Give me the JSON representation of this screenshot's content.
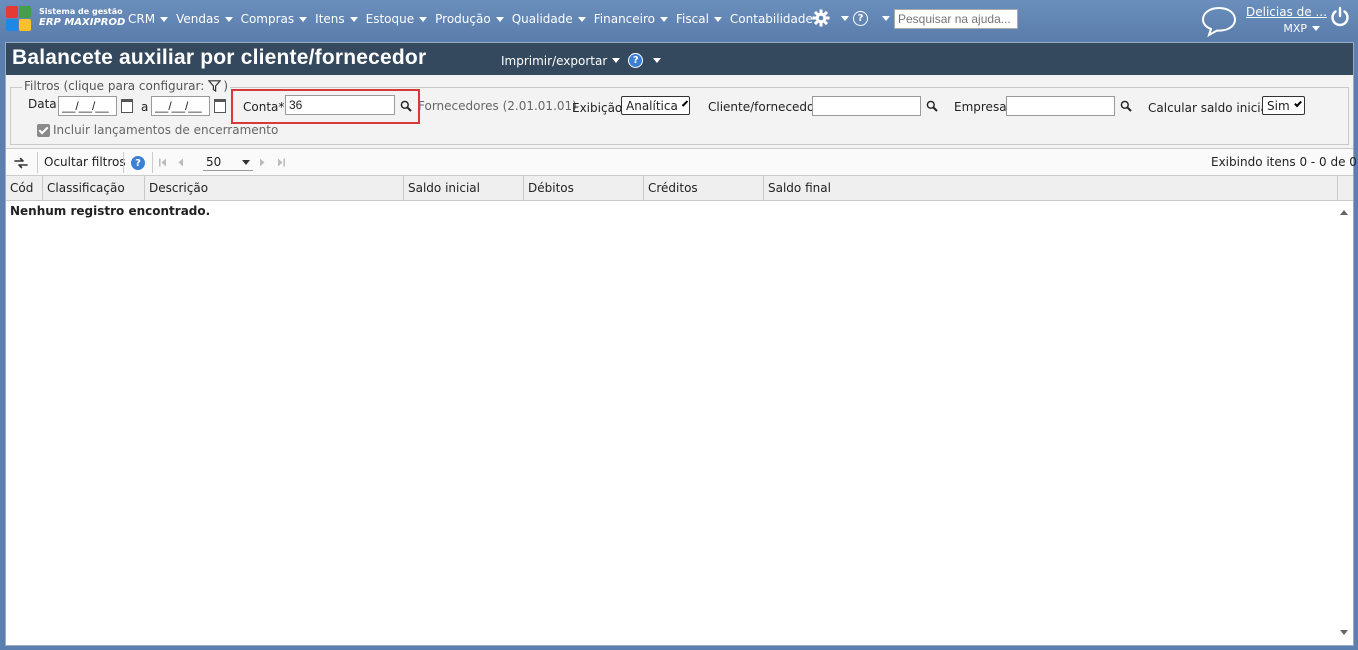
{
  "app": {
    "brand_line1": "Sistema de gestão",
    "brand_line2": "ERP MAXIPROD",
    "menu": [
      "CRM",
      "Vendas",
      "Compras",
      "Itens",
      "Estoque",
      "Produção",
      "Qualidade",
      "Financeiro",
      "Fiscal",
      "Contabilidade"
    ],
    "help_search_placeholder": "Pesquisar na ajuda...",
    "user_name": "Delicias de ...",
    "company": "MXP",
    "icons": [
      "logo-icon",
      "gear-icon",
      "help-icon",
      "chat-icon",
      "power-icon"
    ]
  },
  "page": {
    "title": "Balancete auxiliar por cliente/fornecedor",
    "print_menu": "Imprimir/exportar"
  },
  "filters": {
    "legend": "Filtros (clique para configurar:",
    "legend_close": ")",
    "date_label": "Data",
    "date_from": "__/__/__",
    "date_sep": "a",
    "date_to": "__/__/__",
    "account_label": "Conta*",
    "account_value": "36",
    "account_desc": "Fornecedores (2.01.01.01)",
    "display_label": "Exibição",
    "display_value": "Analítica",
    "client_label": "Cliente/fornecedor",
    "client_value": "",
    "company_label": "Empresa",
    "company_value": "",
    "initial_balance_label": "Calcular saldo inicial",
    "initial_balance_value": "Sim",
    "include_closing_label": "Incluir lançamentos de encerramento",
    "include_closing_checked": true
  },
  "toolbar": {
    "hide_filters": "Ocultar filtros",
    "page_size": "50",
    "items_info": "Exibindo itens 0 - 0 de 0"
  },
  "table": {
    "columns": [
      "Cód",
      "Classificação",
      "Descrição",
      "Saldo inicial",
      "Débitos",
      "Créditos",
      "Saldo final"
    ],
    "empty_message": "Nenhum registro encontrado."
  },
  "colors": {
    "topbar": "#5b7fae",
    "titlebar": "#34495e",
    "highlight": "#d9383a",
    "help_blue": "#3c7fd4"
  }
}
